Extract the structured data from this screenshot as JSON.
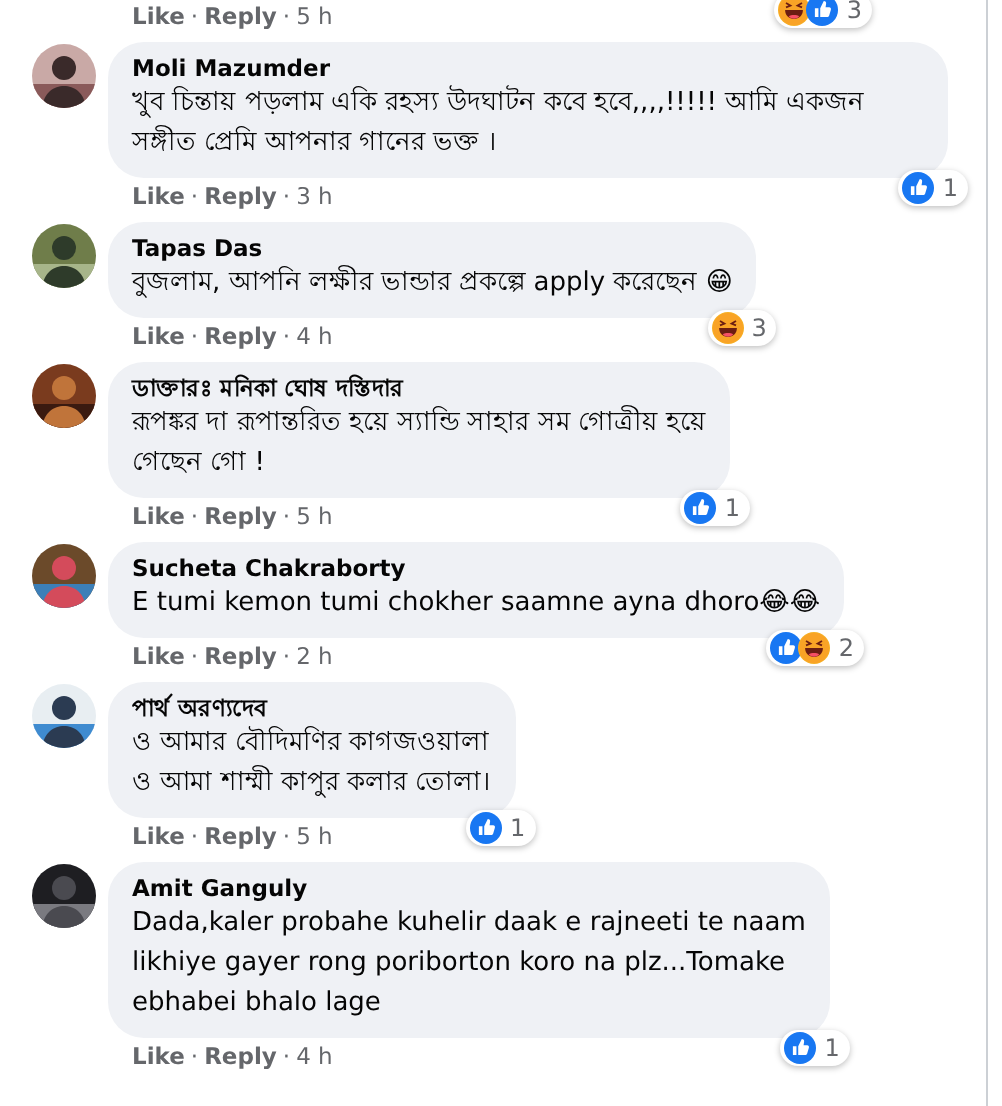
{
  "top_actions": {
    "actions": [
      {
        "kind": "link",
        "text": "Like"
      },
      {
        "kind": "separator",
        "text": "·"
      },
      {
        "kind": "link",
        "text": "Reply"
      },
      {
        "kind": "separator",
        "text": "·"
      },
      {
        "kind": "time",
        "text": "5 h"
      }
    ],
    "reactions": {
      "icons": [
        {
          "kind": "haha"
        },
        {
          "kind": "like"
        }
      ],
      "count": "3"
    }
  },
  "comments": [
    {
      "author": "Moli Mazumder",
      "text": "খুব চিন্তায় পড়লাম একি রহস্য উদঘাটন কবে হবে,,,,!!!!! আমি একজন সঙ্গীত প্রেমি আপনার গানের ভক্ত ।",
      "actions": [
        {
          "kind": "link",
          "text": "Like"
        },
        {
          "kind": "separator",
          "text": "·"
        },
        {
          "kind": "link",
          "text": "Reply"
        },
        {
          "kind": "separator",
          "text": "·"
        },
        {
          "kind": "time",
          "text": "3 h"
        }
      ],
      "reactions": {
        "icons": [
          {
            "kind": "like"
          }
        ],
        "count": "1"
      }
    },
    {
      "author": "Tapas Das",
      "text": "বুজলাম, আপনি লক্ষীর ভান্ডার প্রকল্পে apply করেছেন 😁",
      "actions": [
        {
          "kind": "link",
          "text": "Like"
        },
        {
          "kind": "separator",
          "text": "·"
        },
        {
          "kind": "link",
          "text": "Reply"
        },
        {
          "kind": "separator",
          "text": "·"
        },
        {
          "kind": "time",
          "text": "4 h"
        }
      ],
      "reactions": {
        "icons": [
          {
            "kind": "haha"
          }
        ],
        "count": "3"
      }
    },
    {
      "author": "ডাক্তারঃ মনিকা ঘোষ দস্তিদার",
      "text": "রূপঙ্কর দা রূপান্তরিত হয়ে স্যান্ডি সাহার সম গোত্রীয় হয়ে\nগেছেন গো !",
      "actions": [
        {
          "kind": "link",
          "text": "Like"
        },
        {
          "kind": "separator",
          "text": "·"
        },
        {
          "kind": "link",
          "text": "Reply"
        },
        {
          "kind": "separator",
          "text": "·"
        },
        {
          "kind": "time",
          "text": "5 h"
        }
      ],
      "reactions": {
        "icons": [
          {
            "kind": "like"
          }
        ],
        "count": "1"
      }
    },
    {
      "author": "Sucheta Chakraborty",
      "text": "E tumi kemon tumi chokher saamne ayna dhoro😂😂",
      "actions": [
        {
          "kind": "link",
          "text": "Like"
        },
        {
          "kind": "separator",
          "text": "·"
        },
        {
          "kind": "link",
          "text": "Reply"
        },
        {
          "kind": "separator",
          "text": "·"
        },
        {
          "kind": "time",
          "text": "2 h"
        }
      ],
      "reactions": {
        "icons": [
          {
            "kind": "like"
          },
          {
            "kind": "haha"
          }
        ],
        "count": "2"
      }
    },
    {
      "author": "পার্থ অরণ্যদেব",
      "text": "ও আমার বৌদিমণির কাগজওয়ালা\nও আমা শাম্মী কাপুর কলার তোলা।",
      "actions": [
        {
          "kind": "link",
          "text": "Like"
        },
        {
          "kind": "separator",
          "text": "·"
        },
        {
          "kind": "link",
          "text": "Reply"
        },
        {
          "kind": "separator",
          "text": "·"
        },
        {
          "kind": "time",
          "text": "5 h"
        }
      ],
      "reactions": {
        "icons": [
          {
            "kind": "like"
          }
        ],
        "count": "1"
      }
    },
    {
      "author": "Amit Ganguly",
      "text": "Dada,kaler probahe kuhelir daak e rajneeti te naam\nlikhiye gayer rong poriborton koro na plz...Tomake\nebhabei bhalo lage",
      "actions": [
        {
          "kind": "link",
          "text": "Like"
        },
        {
          "kind": "separator",
          "text": "·"
        },
        {
          "kind": "link",
          "text": "Reply"
        },
        {
          "kind": "separator",
          "text": "·"
        },
        {
          "kind": "time",
          "text": "4 h"
        }
      ],
      "reactions": {
        "icons": [
          {
            "kind": "like"
          }
        ],
        "count": "1"
      }
    }
  ]
}
